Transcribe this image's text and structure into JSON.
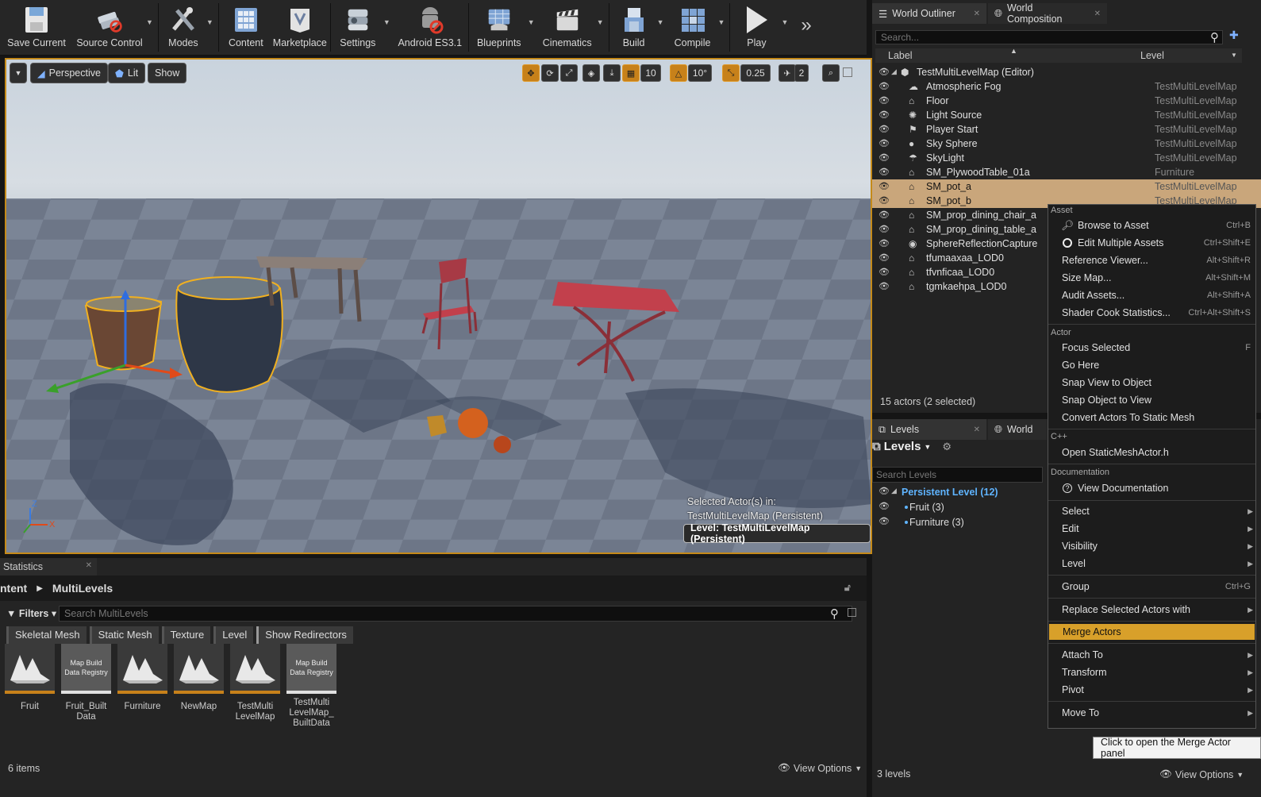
{
  "toolbar": {
    "buttons": [
      {
        "label": "Save Current",
        "icon": "save-icon"
      },
      {
        "label": "Source Control",
        "icon": "source-control-icon"
      },
      {
        "label": "Modes",
        "icon": "modes-icon"
      },
      {
        "label": "Content",
        "icon": "content-icon"
      },
      {
        "label": "Marketplace",
        "icon": "marketplace-icon"
      },
      {
        "label": "Settings",
        "icon": "settings-icon"
      },
      {
        "label": "Android ES3.1",
        "icon": "android-icon"
      },
      {
        "label": "Blueprints",
        "icon": "blueprints-icon"
      },
      {
        "label": "Cinematics",
        "icon": "cinematics-icon"
      },
      {
        "label": "Build",
        "icon": "build-icon"
      },
      {
        "label": "Compile",
        "icon": "compile-icon"
      },
      {
        "label": "Play",
        "icon": "play-icon"
      }
    ],
    "more": "»"
  },
  "viewport": {
    "perspective": "Perspective",
    "lit": "Lit",
    "show": "Show",
    "grid_snap": "10",
    "rot_snap": "10°",
    "scale_snap": "0.25",
    "cam_speed": "2",
    "selected_in_label": "Selected Actor(s) in:",
    "selected_in_value": "TestMultiLevelMap (Persistent)",
    "level_badge": "Level:  TestMultiLevelMap (Persistent)",
    "axis_z": "Z",
    "axis_x": "X"
  },
  "content_browser": {
    "stats_tab": "Statistics",
    "path_root": "ntent",
    "path_current": "MultiLevels",
    "filters_label": "Filters",
    "search_placeholder": "Search MultiLevels",
    "chips": [
      "Skeletal Mesh",
      "Static Mesh",
      "Texture",
      "Level",
      "Show Redirectors"
    ],
    "assets": [
      {
        "name": "Fruit",
        "kind": "level"
      },
      {
        "name": "Fruit_Built\nData",
        "kind": "registry",
        "thumb": "Map Build\nData Registry"
      },
      {
        "name": "Furniture",
        "kind": "level"
      },
      {
        "name": "NewMap",
        "kind": "level"
      },
      {
        "name": "TestMulti\nLevelMap",
        "kind": "level"
      },
      {
        "name": "TestMulti\nLevelMap_\nBuiltData",
        "kind": "registry",
        "thumb": "Map Build\nData Registry"
      }
    ],
    "count": "6 items",
    "view_options": "View Options"
  },
  "outliner": {
    "tab1": "World Outliner",
    "tab2": "World Composition",
    "search_placeholder": "Search...",
    "col_label": "Label",
    "col_level": "Level",
    "rows": [
      {
        "label": "TestMultiLevelMap (Editor)",
        "level": "",
        "indent": 0,
        "sel": false,
        "icon": "world-icon"
      },
      {
        "label": "Atmospheric Fog",
        "level": "TestMultiLevelMap",
        "indent": 1,
        "sel": false,
        "icon": "fog-icon"
      },
      {
        "label": "Floor",
        "level": "TestMultiLevelMap",
        "indent": 1,
        "sel": false,
        "icon": "static-mesh-icon"
      },
      {
        "label": "Light Source",
        "level": "TestMultiLevelMap",
        "indent": 1,
        "sel": false,
        "icon": "light-icon"
      },
      {
        "label": "Player Start",
        "level": "TestMultiLevelMap",
        "indent": 1,
        "sel": false,
        "icon": "player-start-icon"
      },
      {
        "label": "Sky Sphere",
        "level": "TestMultiLevelMap",
        "indent": 1,
        "sel": false,
        "icon": "sphere-icon"
      },
      {
        "label": "SkyLight",
        "level": "TestMultiLevelMap",
        "indent": 1,
        "sel": false,
        "icon": "skylight-icon"
      },
      {
        "label": "SM_PlywoodTable_01a",
        "level": "Furniture",
        "indent": 1,
        "sel": false,
        "icon": "static-mesh-icon"
      },
      {
        "label": "SM_pot_a",
        "level": "TestMultiLevelMap",
        "indent": 1,
        "sel": true,
        "icon": "static-mesh-icon"
      },
      {
        "label": "SM_pot_b",
        "level": "TestMultiLevelMap",
        "indent": 1,
        "sel": true,
        "icon": "static-mesh-icon"
      },
      {
        "label": "SM_prop_dining_chair_a",
        "level": "",
        "indent": 1,
        "sel": false,
        "icon": "static-mesh-icon"
      },
      {
        "label": "SM_prop_dining_table_a",
        "level": "",
        "indent": 1,
        "sel": false,
        "icon": "static-mesh-icon"
      },
      {
        "label": "SphereReflectionCapture",
        "level": "",
        "indent": 1,
        "sel": false,
        "icon": "reflection-icon"
      },
      {
        "label": "tfumaaxaa_LOD0",
        "level": "",
        "indent": 1,
        "sel": false,
        "icon": "static-mesh-icon"
      },
      {
        "label": "tfvnficaa_LOD0",
        "level": "",
        "indent": 1,
        "sel": false,
        "icon": "static-mesh-icon"
      },
      {
        "label": "tgmkaehpa_LOD0",
        "level": "",
        "indent": 1,
        "sel": false,
        "icon": "static-mesh-icon"
      }
    ],
    "footer": "15 actors (2 selected)"
  },
  "levels": {
    "tab1": "Levels",
    "tab2": "World",
    "title": "Levels",
    "search_placeholder": "Search Levels",
    "rows": [
      {
        "label": "Persistent Level (12)",
        "persistent": true
      },
      {
        "label": "Fruit (3)",
        "persistent": false
      },
      {
        "label": "Furniture (3)",
        "persistent": false
      }
    ],
    "count": "3 levels",
    "view_options": "View Options"
  },
  "context_menu": {
    "sections": {
      "asset": "Asset",
      "actor": "Actor",
      "cpp": "C++",
      "documentation": "Documentation"
    },
    "asset_items": [
      {
        "label": "Browse to Asset",
        "shortcut": "Ctrl+B",
        "icon": "browse-icon"
      },
      {
        "label": "Edit Multiple Assets",
        "shortcut": "Ctrl+Shift+E",
        "icon": "edit-multiple-icon"
      },
      {
        "label": "Reference Viewer...",
        "shortcut": "Alt+Shift+R"
      },
      {
        "label": "Size Map...",
        "shortcut": "Alt+Shift+M"
      },
      {
        "label": "Audit Assets...",
        "shortcut": "Alt+Shift+A"
      },
      {
        "label": "Shader Cook Statistics...",
        "shortcut": "Ctrl+Alt+Shift+S"
      }
    ],
    "actor_items": [
      {
        "label": "Focus Selected",
        "shortcut": "F"
      },
      {
        "label": "Go Here",
        "shortcut": ""
      },
      {
        "label": "Snap View to Object",
        "shortcut": ""
      },
      {
        "label": "Snap Object to View",
        "shortcut": ""
      },
      {
        "label": "Convert Actors To Static Mesh",
        "shortcut": ""
      }
    ],
    "cpp_items": [
      {
        "label": "Open StaticMeshActor.h"
      }
    ],
    "doc_items": [
      {
        "label": "View Documentation",
        "icon": "help-icon"
      }
    ],
    "submenus_a": [
      "Select",
      "Edit",
      "Visibility",
      "Level"
    ],
    "group": {
      "label": "Group",
      "shortcut": "Ctrl+G"
    },
    "replace": "Replace Selected Actors with",
    "merge": "Merge Actors",
    "submenus_b": [
      "Attach To",
      "Transform",
      "Pivot"
    ],
    "move_to": "Move To"
  },
  "tooltip": "Click to open the Merge Actor panel",
  "colors": {
    "accent": "#c7811a",
    "highlight": "#d8a02a",
    "selection": "#c9a67b",
    "persistent": "#5fb4ff"
  }
}
